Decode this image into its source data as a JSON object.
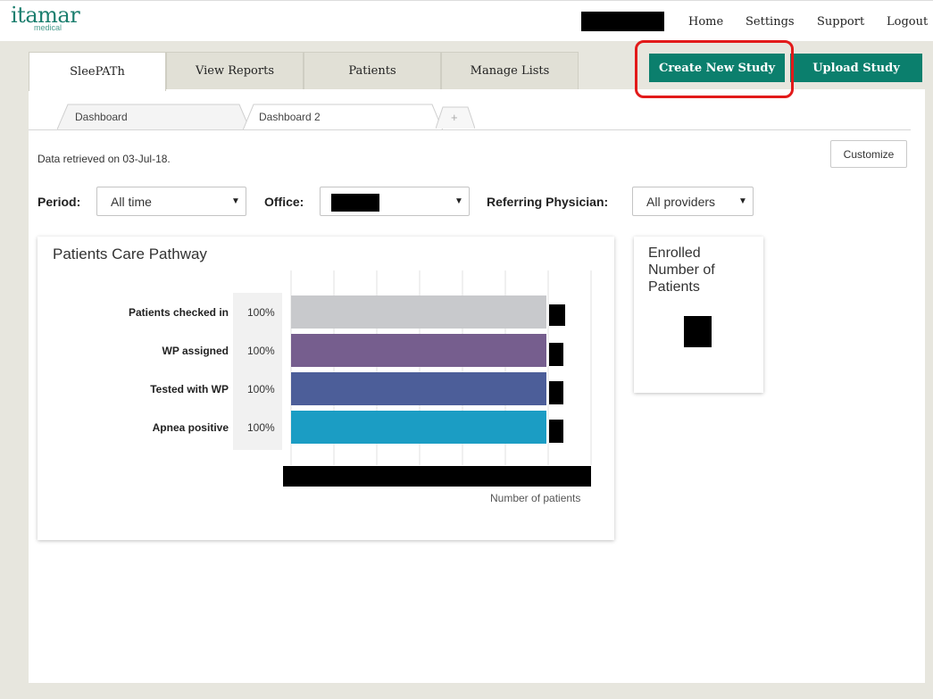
{
  "header": {
    "logo_main": "itamar",
    "logo_sub": "medical",
    "nav": [
      "Home",
      "Settings",
      "Support",
      "Logout"
    ]
  },
  "tabs": [
    "SleePATh",
    "View Reports",
    "Patients",
    "Manage Lists"
  ],
  "actions": {
    "create_new_study": "Create New Study",
    "upload_study": "Upload Study"
  },
  "subtabs": [
    "Dashboard",
    "Dashboard 2"
  ],
  "add_tab_symbol": "+",
  "info": {
    "retrieved": "Data retrieved on 03-Jul-18.",
    "customize": "Customize"
  },
  "filters": {
    "period_label": "Period:",
    "period_value": "All time",
    "office_label": "Office:",
    "physician_label": "Referring Physician:",
    "physician_value": "All providers",
    "caret": "▼"
  },
  "pathway_card": {
    "title": "Patients Care Pathway",
    "axis_title": "Number of patients"
  },
  "chart_data": {
    "type": "bar",
    "orientation": "horizontal",
    "categories": [
      "Patients checked in",
      "WP assigned",
      "Tested with WP",
      "Apnea positive"
    ],
    "percent_labels": [
      "100%",
      "100%",
      "100%",
      "100%"
    ],
    "colors": [
      "#c8c9cc",
      "#765e8e",
      "#4c5e99",
      "#1b9dc4"
    ],
    "xlabel": "Number of patients",
    "grid": true
  },
  "enrolled_card": {
    "title_lines": [
      "Enrolled",
      "Number of",
      "Patients"
    ]
  },
  "colors": {
    "brand": "#1b7e6e",
    "button": "#0b7f6d",
    "highlight": "#e21a1a"
  }
}
